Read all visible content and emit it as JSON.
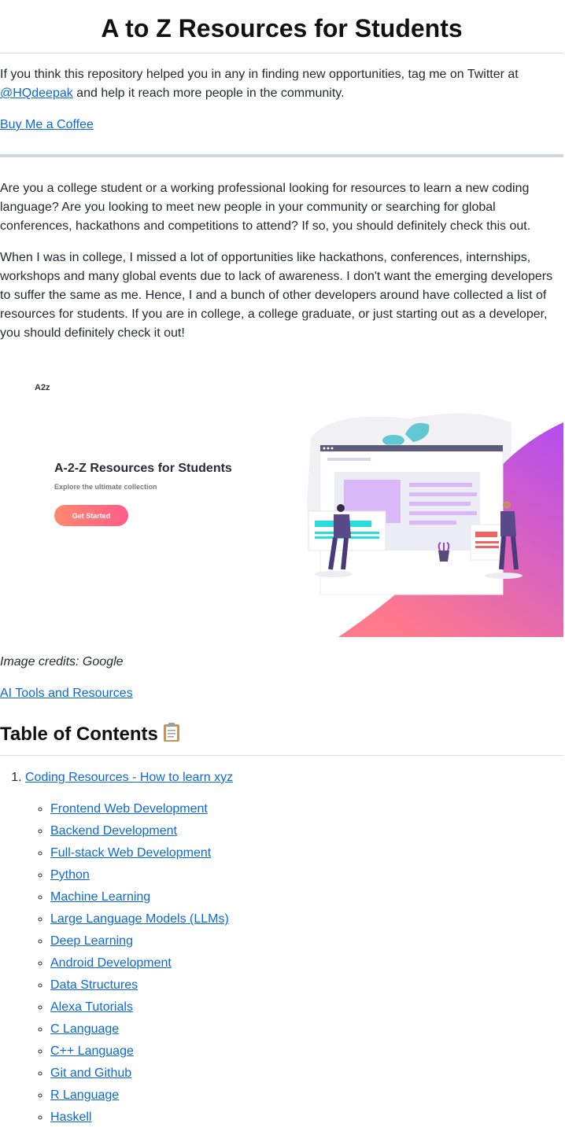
{
  "title": "A to Z Resources for Students",
  "intro": {
    "text_before": "If you think this repository helped you in any in finding new opportunities, tag me on Twitter at ",
    "twitter_handle": "@HQdeepak",
    "text_after": " and help it reach more people in the community."
  },
  "coffee_link": "Buy Me a Coffee",
  "description": [
    "Are you a college student or a working professional looking for resources to learn a new coding language? Are you looking to meet new people in your community or searching for global conferences, hackathons and competitions to attend? If so, you should definitely check this out.",
    "When I was in college, I missed a lot of opportunities like hackathons, conferences, internships, workshops and many global events due to lack of awareness. I don't want the emerging developers to suffer the same as me. Hence, I and a bunch of other developers around have collected a list of resources for students. If you are in college, a college graduate, or just starting out as a developer, you should definitely check it out!"
  ],
  "banner": {
    "logo": "A2z",
    "headline": "A-2-Z Resources for Students",
    "subheadline": "Explore the ultimate collection",
    "button": "Get Started"
  },
  "image_credits": "Image credits: Google",
  "ai_link": "AI Tools and Resources",
  "toc": {
    "heading": "Table of Contents",
    "icon": "clipboard-icon",
    "items": [
      {
        "label": "Coding Resources - How to learn xyz",
        "sub": [
          "Frontend Web Development",
          "Backend Development",
          "Full-stack Web Development",
          "Python",
          "Machine Learning",
          "Large Language Models (LLMs)",
          "Deep Learning",
          "Android Development",
          "Data Structures",
          "Alexa Tutorials",
          "C Language",
          "C++ Language",
          "Git and Github",
          "R Language",
          "Haskell"
        ]
      }
    ]
  },
  "colors": {
    "link": "#0969da",
    "banner_gradient_start": "#b44cf0",
    "banner_gradient_end": "#ff7a8a",
    "button_gradient_start": "#ff8a6b",
    "button_gradient_end": "#ff5c8a"
  }
}
